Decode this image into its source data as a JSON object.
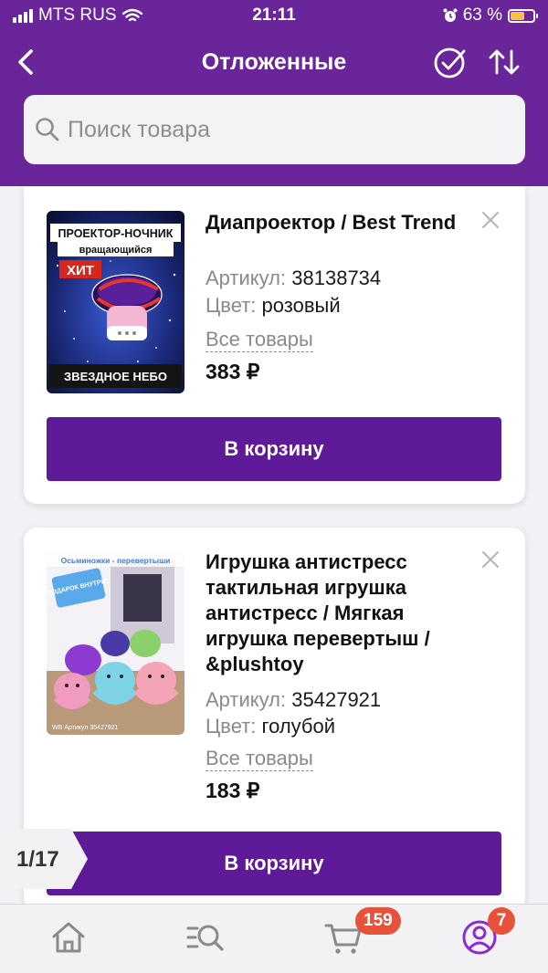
{
  "status_bar": {
    "carrier": "MTS RUS",
    "time": "21:11",
    "battery": "63 %",
    "battery_level": 0.63
  },
  "header": {
    "title": "Отложенные"
  },
  "search": {
    "placeholder": "Поиск товара"
  },
  "products": [
    {
      "name": "Диапроектор / Best Trend",
      "article_label": "Артикул:",
      "article": "38138734",
      "color_label": "Цвет:",
      "color": "розовый",
      "all_goods": "Все товары",
      "price": "383 ₽",
      "cart_button": "В корзину",
      "image_text": {
        "line1": "ПРОЕКТОР-НОЧНИК",
        "line2": "вращающийся",
        "badge": "ХИТ",
        "bottom": "ЗВЕЗДНОЕ НЕБО"
      }
    },
    {
      "name": "Игрушка антистресс тактильная игрушка антистресс / Мягкая игрушка перевертыш / &plushtoy",
      "article_label": "Артикул:",
      "article": "35427921",
      "color_label": "Цвет:",
      "color": "голубой",
      "all_goods": "Все товары",
      "price": "183 ₽",
      "cart_button": "В корзину",
      "image_text": {
        "top": "Осьминожки - перевертыши",
        "sticker": "ПОДАРОК ВНУТРИ!",
        "bottom": "WB Артикул 35427921"
      }
    }
  ],
  "pager": {
    "text": "1/17"
  },
  "tabbar": {
    "cart_badge": "159",
    "profile_badge": "7"
  },
  "colors": {
    "brand": "#6a259a",
    "button": "#5e1a99",
    "badge": "#e8513a"
  }
}
